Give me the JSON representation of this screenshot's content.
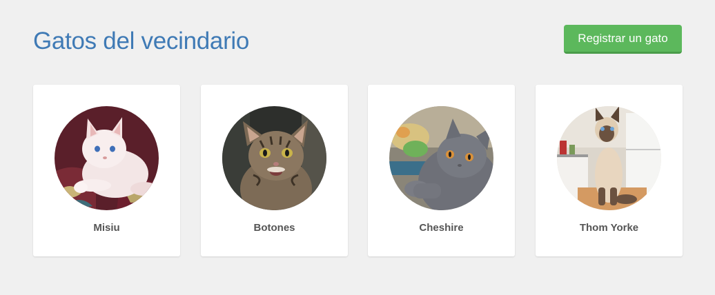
{
  "header": {
    "title": "Gatos del vecindario",
    "register_button_label": "Registrar un gato"
  },
  "cats": [
    {
      "name": "Misiu",
      "photo_icon": "white-cat-photo"
    },
    {
      "name": "Botones",
      "photo_icon": "tabby-kitten-photo"
    },
    {
      "name": "Cheshire",
      "photo_icon": "gray-cat-photo"
    },
    {
      "name": "Thom Yorke",
      "photo_icon": "siamese-cat-photo"
    }
  ],
  "colors": {
    "background": "#f0f0f0",
    "title": "#3f7ab5",
    "button": "#5cb85c",
    "card": "#ffffff",
    "name_text": "#555555"
  }
}
